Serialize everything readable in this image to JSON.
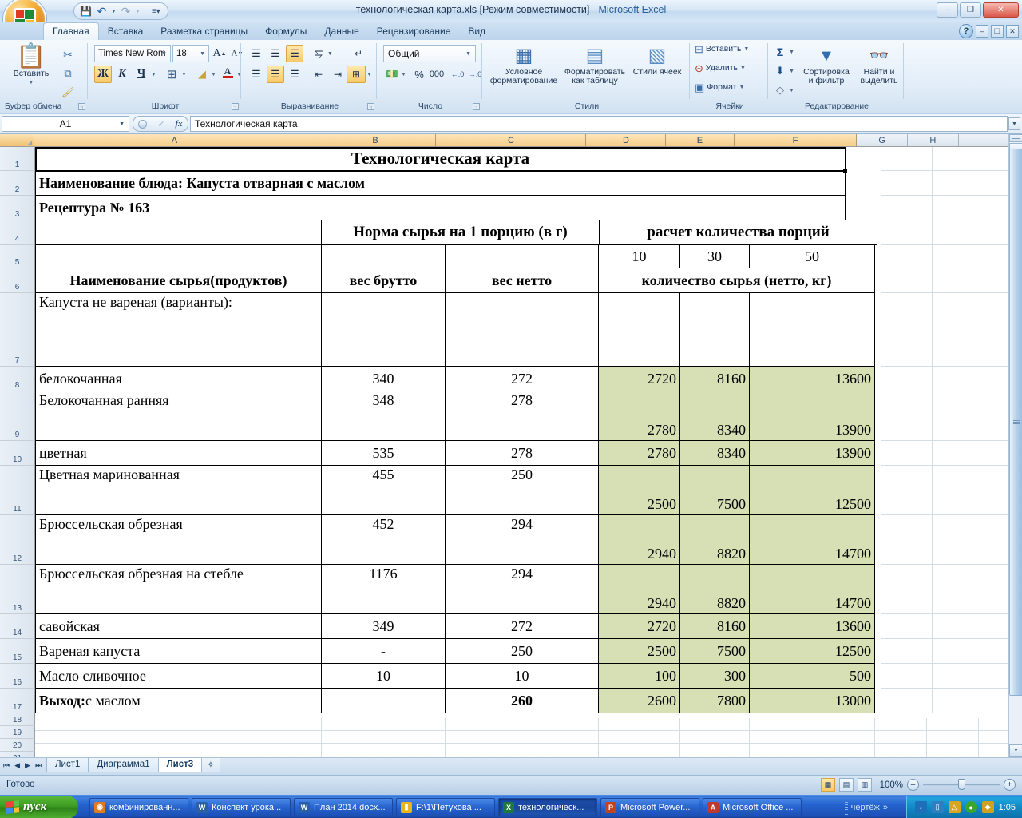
{
  "window": {
    "title": "технологическая карта.xls  [Режим совместимости] - Microsoft Excel",
    "title_file": "технологическая карта.xls  [Режим совместимости] - ",
    "title_app": "Microsoft Excel",
    "minimize": "–",
    "restore": "❐",
    "close": "✕"
  },
  "quick_access": {
    "save": "💾",
    "undo": "↰",
    "redo": "↱",
    "more": "▾"
  },
  "ribbon": {
    "tabs": [
      {
        "label": "Главная",
        "active": true
      },
      {
        "label": "Вставка",
        "active": false
      },
      {
        "label": "Разметка страницы",
        "active": false
      },
      {
        "label": "Формулы",
        "active": false
      },
      {
        "label": "Данные",
        "active": false
      },
      {
        "label": "Рецензирование",
        "active": false
      },
      {
        "label": "Вид",
        "active": false
      }
    ],
    "help": "?",
    "groups": {
      "clipboard": {
        "title": "Буфер обмена",
        "paste": "Вставить",
        "cut": "✂",
        "copy": "⧉",
        "format_painter": "🖌"
      },
      "font": {
        "title": "Шрифт",
        "font_name": "Times New Rom",
        "font_size": "18",
        "grow": "A",
        "shrink": "A",
        "bold": "Ж",
        "italic": "К",
        "underline": "Ч",
        "borders": "⊞",
        "fill": "▨",
        "color": "A"
      },
      "alignment": {
        "title": "Выравнивание",
        "align_top": "≡",
        "align_middle": "≡",
        "align_bottom": "≡",
        "orientation": "⟋",
        "align_left": "≡",
        "align_center": "≡",
        "align_right": "≡",
        "decrease_indent": "⇤",
        "increase_indent": "⇥",
        "wrap_text": "⏎",
        "merge_center": "⊞"
      },
      "number": {
        "title": "Число",
        "format": "Общий",
        "currency": "₽",
        "percent": "%",
        "thousands": "000",
        "inc_decimal": "→.0",
        "dec_decimal": "←.00"
      },
      "styles": {
        "title": "Стили",
        "conditional": "Условное форматирование",
        "as_table": "Форматировать как таблицу",
        "cell_styles": "Стили ячеек"
      },
      "cells": {
        "title": "Ячейки",
        "insert": "Вставить",
        "delete": "Удалить",
        "format": "Формат"
      },
      "editing": {
        "title": "Редактирование",
        "autosum": "Σ",
        "fill": "⬇",
        "clear": "◇",
        "sort_filter": "Сортировка и фильтр",
        "find_select": "Найти и выделить"
      }
    }
  },
  "formula_bar": {
    "name_box": "A1",
    "fx": "fx",
    "value": "Технологическая карта"
  },
  "grid": {
    "column_headers": [
      "A",
      "B",
      "C",
      "D",
      "E",
      "F",
      "G",
      "H"
    ],
    "row_numbers": [
      "1",
      "2",
      "3",
      "4",
      "5",
      "6",
      "7",
      "8",
      "9",
      "10",
      "11",
      "12",
      "13",
      "14",
      "15",
      "16",
      "17",
      "18",
      "19",
      "20",
      "21"
    ]
  },
  "sheet": {
    "title": "Технологическая карта",
    "dish_line": "Наименование блюда: Капуста отварная с маслом",
    "recipe_line": "Рецептура № 163",
    "header_norm": "Норма сырья на 1 порцию (в г)",
    "header_calc": "расчет количества порций",
    "portions": [
      "10",
      "30",
      "50"
    ],
    "col_name": "Наименование сырья(продуктов)",
    "col_gross": "вес брутто",
    "col_net": "вес нетто",
    "header_qty": "количество сырья (нетто, кг)",
    "group_row": "Капуста не вареная (варианты):",
    "rows": [
      {
        "name": "белокочанная",
        "gross": "340",
        "net": "272",
        "p10": "2720",
        "p30": "8160",
        "p50": "13600"
      },
      {
        "name": "Белокочанная ранняя",
        "gross": "348",
        "net": "278",
        "p10": "2780",
        "p30": "8340",
        "p50": "13900"
      },
      {
        "name": "цветная",
        "gross": "535",
        "net": "278",
        "p10": "2780",
        "p30": "8340",
        "p50": "13900"
      },
      {
        "name": "Цветная маринованная",
        "gross": "455",
        "net": "250",
        "p10": "2500",
        "p30": "7500",
        "p50": "12500"
      },
      {
        "name": "Брюссельская обрезная",
        "gross": "452",
        "net": "294",
        "p10": "2940",
        "p30": "8820",
        "p50": "14700"
      },
      {
        "name": "Брюссельская обрезная на стебле",
        "gross": "1176",
        "net": "294",
        "p10": "2940",
        "p30": "8820",
        "p50": "14700"
      },
      {
        "name": "савойская",
        "gross": "349",
        "net": "272",
        "p10": "2720",
        "p30": "8160",
        "p50": "13600"
      },
      {
        "name": "Вареная капуста",
        "gross": "-",
        "net": "250",
        "p10": "2500",
        "p30": "7500",
        "p50": "12500"
      },
      {
        "name": "Масло сливочное",
        "gross": "10",
        "net": "10",
        "p10": "100",
        "p30": "300",
        "p50": "500"
      }
    ],
    "total": {
      "name_bold": "Выход:",
      "name_rest": " с маслом",
      "gross": "",
      "net": "260",
      "p10": "2600",
      "p30": "7800",
      "p50": "13000"
    }
  },
  "sheet_tabs": {
    "first": "⏮",
    "prev": "◀",
    "next": "▶",
    "last": "⏭",
    "items": [
      {
        "label": "Лист1",
        "active": false
      },
      {
        "label": "Диаграмма1",
        "active": false
      },
      {
        "label": "Лист3",
        "active": true
      }
    ],
    "new_sheet": "✧"
  },
  "status": {
    "text": "Готово",
    "view_normal": "▦",
    "view_layout": "▤",
    "view_break": "▥",
    "zoom": "100%",
    "zoom_out": "–",
    "zoom_in": "+"
  },
  "taskbar": {
    "start": "пуск",
    "items": [
      {
        "label": "комбинированн...",
        "icon": "◉",
        "color": "#e07b1f",
        "active": false
      },
      {
        "label": "Конспект урока...",
        "icon": "W",
        "color": "#2a5fa8",
        "active": false
      },
      {
        "label": "План 2014.docx...",
        "icon": "W",
        "color": "#2a5fa8",
        "active": false
      },
      {
        "label": "F:\\1\\Петухова ...",
        "icon": "📁",
        "color": "#e8b422",
        "active": false
      },
      {
        "label": "технологическ...",
        "icon": "X",
        "color": "#1d7a3c",
        "active": true
      },
      {
        "label": "Microsoft Power...",
        "icon": "P",
        "color": "#c5431c",
        "active": false
      },
      {
        "label": "Microsoft Office ...",
        "icon": "A",
        "color": "#c0392b",
        "active": false
      }
    ],
    "quicklaunch_label": "чертёж",
    "quicklaunch_more": "»",
    "tray": [
      {
        "icon": "‹",
        "color": "#1c6fb8"
      },
      {
        "icon": "🖥",
        "color": "#2f7fc0"
      },
      {
        "icon": "📶",
        "color": "#d9a520"
      },
      {
        "icon": "◕",
        "color": "#3aa62a"
      },
      {
        "icon": "🔒",
        "color": "#d0a021"
      }
    ],
    "clock": "1:05"
  },
  "colors": {
    "green_fill": "#d7dfb4",
    "header_orange": "#f5cd88",
    "accent_blue": "#2a6099"
  }
}
